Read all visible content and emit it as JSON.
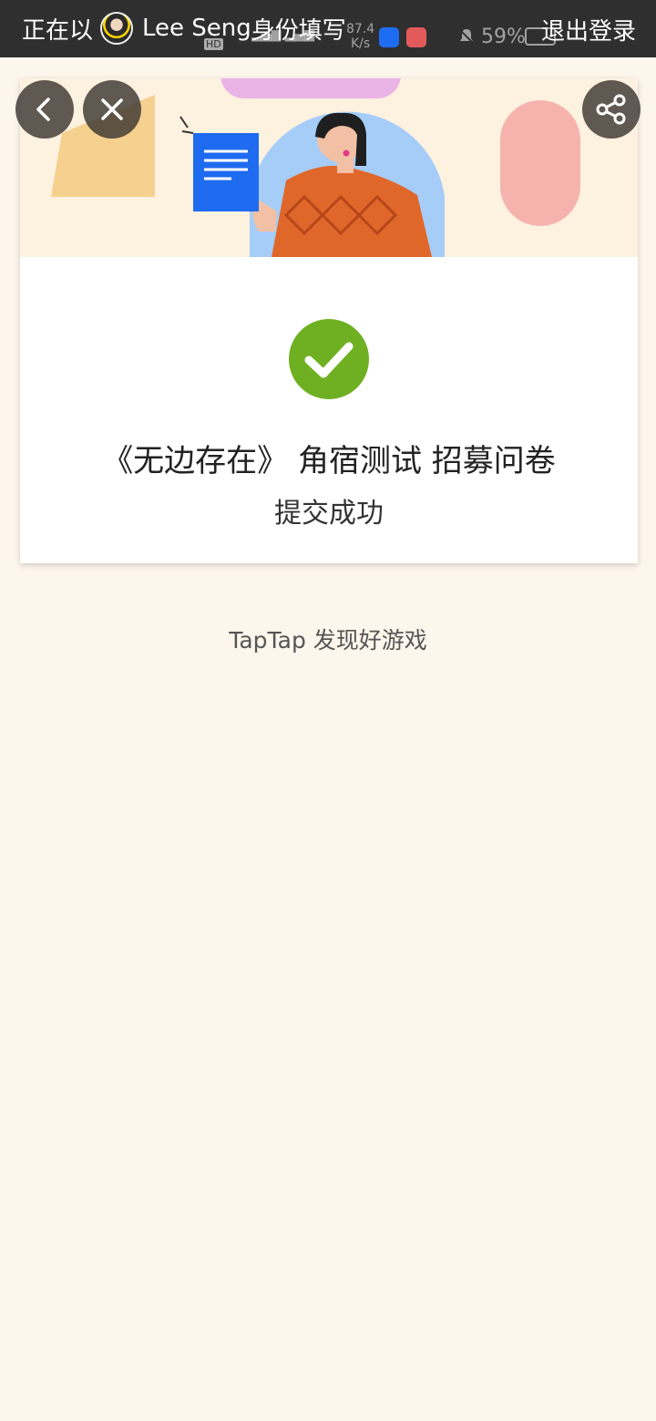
{
  "topbar": {
    "identity_prefix": "正在以",
    "user_name": "Lee Seng",
    "identity_suffix": "身份填写",
    "logout_label": "退出登录"
  },
  "status_bar": {
    "hd_label": "HD",
    "net_speed": "87.4",
    "net_unit": "K/s",
    "battery": "59%"
  },
  "nav": {
    "back_icon": "chevron-left-icon",
    "close_icon": "close-icon",
    "share_icon": "share-icon"
  },
  "result": {
    "icon": "check-circle-icon",
    "title": "《无边存在》 角宿测试 招募问卷",
    "status": "提交成功"
  },
  "footer": {
    "brand": "TapTap 发现好游戏"
  },
  "colors": {
    "background": "#fdf6ec",
    "success": "#6fb022",
    "topbar": "#2f2f2f"
  }
}
